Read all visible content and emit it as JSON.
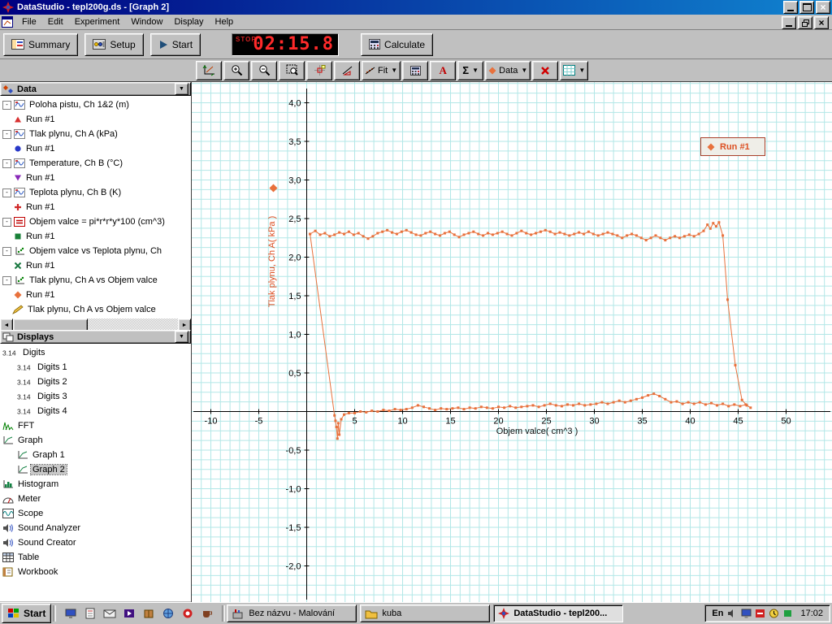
{
  "titlebar": {
    "title": "DataStudio - tepl200g.ds - [Graph 2]"
  },
  "menu": {
    "items": [
      "File",
      "Edit",
      "Experiment",
      "Window",
      "Display",
      "Help"
    ]
  },
  "toolbar": {
    "summary_label": "Summary",
    "setup_label": "Setup",
    "start_label": "Start",
    "calculate_label": "Calculate",
    "timer_stop": "STOP",
    "timer_value": "02:15.8"
  },
  "graph_toolbar": {
    "fit_label": "Fit",
    "sigma_label": "Σ",
    "text_label": "A",
    "data_label": "Data"
  },
  "data_panel": {
    "title": "Data",
    "items": [
      {
        "type": "source",
        "label": "Poloha pistu, Ch 1&2 (m)",
        "icon": "measurement-icon"
      },
      {
        "type": "run",
        "label": "Run #1",
        "marker": "triangle-up",
        "color": "#d83030"
      },
      {
        "type": "source",
        "label": "Tlak plynu, Ch A (kPa)",
        "icon": "measurement-icon"
      },
      {
        "type": "run",
        "label": "Run #1",
        "marker": "circle",
        "color": "#2838c8"
      },
      {
        "type": "source",
        "label": "Temperature, Ch B (°C)",
        "icon": "measurement-icon"
      },
      {
        "type": "run",
        "label": "Run #1",
        "marker": "triangle-down",
        "color": "#8828b8"
      },
      {
        "type": "source",
        "label": "Teplota plynu, Ch B (K)",
        "icon": "measurement-icon"
      },
      {
        "type": "run",
        "label": "Run #1",
        "marker": "plus",
        "color": "#d02828"
      },
      {
        "type": "source",
        "label": "Objem valce = pi*r*r*y*100 (cm^3)",
        "icon": "calculator-tree-icon"
      },
      {
        "type": "run",
        "label": "Run #1",
        "marker": "square",
        "color": "#188038"
      },
      {
        "type": "source",
        "label": "Objem valce vs Teplota plynu, Ch",
        "icon": "xy-icon"
      },
      {
        "type": "run",
        "label": "Run #1",
        "marker": "x",
        "color": "#187840"
      },
      {
        "type": "source",
        "label": "Tlak plynu, Ch A vs Objem valce",
        "icon": "xy-icon"
      },
      {
        "type": "run",
        "label": "Run #1",
        "marker": "diamond",
        "color": "#e8713c"
      },
      {
        "type": "source",
        "label": "Tlak plynu, Ch A vs Objem valce",
        "icon": "pen-icon",
        "expand": false
      }
    ]
  },
  "displays_panel": {
    "title": "Displays",
    "items": [
      {
        "label": "Digits",
        "icon": "digits-icon",
        "indent": 0
      },
      {
        "label": "Digits 1",
        "icon": "digits-icon",
        "indent": 1
      },
      {
        "label": "Digits 2",
        "icon": "digits-icon",
        "indent": 1
      },
      {
        "label": "Digits 3",
        "icon": "digits-icon",
        "indent": 1
      },
      {
        "label": "Digits 4",
        "icon": "digits-icon",
        "indent": 1
      },
      {
        "label": "FFT",
        "icon": "fft-icon",
        "indent": 0
      },
      {
        "label": "Graph",
        "icon": "graph-icon",
        "indent": 0
      },
      {
        "label": "Graph 1",
        "icon": "graph-icon",
        "indent": 1
      },
      {
        "label": "Graph 2",
        "icon": "graph-icon",
        "indent": 1,
        "selected": true
      },
      {
        "label": "Histogram",
        "icon": "histogram-icon",
        "indent": 0
      },
      {
        "label": "Meter",
        "icon": "meter-icon",
        "indent": 0
      },
      {
        "label": "Scope",
        "icon": "scope-icon",
        "indent": 0
      },
      {
        "label": "Sound Analyzer",
        "icon": "sound-icon",
        "indent": 0
      },
      {
        "label": "Sound Creator",
        "icon": "sound-icon",
        "indent": 0
      },
      {
        "label": "Table",
        "icon": "table-icon",
        "indent": 0
      },
      {
        "label": "Workbook",
        "icon": "workbook-icon",
        "indent": 0
      }
    ]
  },
  "chart_data": {
    "type": "line",
    "title": "Graph 2",
    "xlabel": "Objem valce( cm^3 )",
    "ylabel": "Tlak plynu, Ch A( kPa )",
    "xlim": [
      -12,
      55
    ],
    "ylim": [
      -2.5,
      4.3
    ],
    "grid": true,
    "grid_color": "#b2e7e7",
    "legend": {
      "label": "Run #1",
      "marker": "diamond",
      "position": "top-right"
    },
    "x_ticks": [
      [
        -10,
        "-10"
      ],
      [
        -5,
        "-5"
      ],
      [
        5,
        "5"
      ],
      [
        10,
        "10"
      ],
      [
        15,
        "15"
      ],
      [
        20,
        "20"
      ],
      [
        25,
        "25"
      ],
      [
        30,
        "30"
      ],
      [
        35,
        "35"
      ],
      [
        40,
        "40"
      ],
      [
        45,
        "45"
      ],
      [
        50,
        "50"
      ]
    ],
    "y_ticks": [
      [
        4,
        "4,0"
      ],
      [
        3.5,
        "3,5"
      ],
      [
        3,
        "3,0"
      ],
      [
        2.5,
        "2,5"
      ],
      [
        2,
        "2,0"
      ],
      [
        1.5,
        "1,5"
      ],
      [
        1,
        "1,0"
      ],
      [
        0.5,
        "0,5"
      ],
      [
        -0.5,
        "-0,5"
      ],
      [
        -1,
        "-1,0"
      ],
      [
        -1.5,
        "-1,5"
      ],
      [
        -2,
        "-2,0"
      ]
    ],
    "series": [
      {
        "name": "Run #1",
        "color": "#e8713c",
        "points": [
          [
            0.35,
            2.3
          ],
          [
            0.9,
            2.34
          ],
          [
            1.4,
            2.29
          ],
          [
            1.9,
            2.31
          ],
          [
            2.4,
            2.27
          ],
          [
            2.9,
            2.29
          ],
          [
            3.4,
            2.32
          ],
          [
            3.9,
            2.3
          ],
          [
            4.4,
            2.33
          ],
          [
            4.9,
            2.29
          ],
          [
            5.4,
            2.31
          ],
          [
            5.9,
            2.27
          ],
          [
            6.4,
            2.24
          ],
          [
            6.9,
            2.27
          ],
          [
            7.4,
            2.31
          ],
          [
            7.9,
            2.33
          ],
          [
            8.4,
            2.35
          ],
          [
            8.9,
            2.32
          ],
          [
            9.4,
            2.3
          ],
          [
            9.9,
            2.33
          ],
          [
            10.4,
            2.35
          ],
          [
            10.9,
            2.32
          ],
          [
            11.4,
            2.29
          ],
          [
            11.9,
            2.28
          ],
          [
            12.4,
            2.31
          ],
          [
            12.9,
            2.33
          ],
          [
            13.4,
            2.3
          ],
          [
            13.9,
            2.28
          ],
          [
            14.4,
            2.31
          ],
          [
            14.9,
            2.33
          ],
          [
            15.4,
            2.29
          ],
          [
            15.9,
            2.26
          ],
          [
            16.4,
            2.29
          ],
          [
            16.9,
            2.31
          ],
          [
            17.4,
            2.33
          ],
          [
            17.9,
            2.3
          ],
          [
            18.4,
            2.28
          ],
          [
            18.9,
            2.31
          ],
          [
            19.4,
            2.29
          ],
          [
            19.9,
            2.31
          ],
          [
            20.4,
            2.33
          ],
          [
            20.9,
            2.3
          ],
          [
            21.4,
            2.28
          ],
          [
            21.9,
            2.31
          ],
          [
            22.4,
            2.34
          ],
          [
            22.9,
            2.31
          ],
          [
            23.4,
            2.29
          ],
          [
            23.9,
            2.31
          ],
          [
            24.4,
            2.33
          ],
          [
            24.9,
            2.35
          ],
          [
            25.4,
            2.33
          ],
          [
            25.9,
            2.3
          ],
          [
            26.4,
            2.32
          ],
          [
            26.9,
            2.3
          ],
          [
            27.4,
            2.28
          ],
          [
            27.9,
            2.3
          ],
          [
            28.4,
            2.32
          ],
          [
            28.9,
            2.3
          ],
          [
            29.4,
            2.33
          ],
          [
            29.9,
            2.3
          ],
          [
            30.4,
            2.28
          ],
          [
            30.9,
            2.3
          ],
          [
            31.4,
            2.32
          ],
          [
            31.9,
            2.3
          ],
          [
            32.4,
            2.28
          ],
          [
            32.9,
            2.25
          ],
          [
            33.4,
            2.28
          ],
          [
            33.9,
            2.3
          ],
          [
            34.4,
            2.28
          ],
          [
            34.9,
            2.25
          ],
          [
            35.4,
            2.22
          ],
          [
            35.9,
            2.25
          ],
          [
            36.4,
            2.28
          ],
          [
            36.9,
            2.25
          ],
          [
            37.4,
            2.22
          ],
          [
            37.9,
            2.25
          ],
          [
            38.4,
            2.27
          ],
          [
            38.9,
            2.25
          ],
          [
            39.4,
            2.27
          ],
          [
            39.9,
            2.29
          ],
          [
            40.4,
            2.27
          ],
          [
            40.9,
            2.3
          ],
          [
            41.4,
            2.34
          ],
          [
            41.8,
            2.42
          ],
          [
            42.1,
            2.37
          ],
          [
            42.4,
            2.44
          ],
          [
            42.7,
            2.4
          ],
          [
            43.0,
            2.45
          ],
          [
            43.4,
            2.28
          ],
          [
            43.9,
            1.45
          ],
          [
            44.7,
            0.6
          ],
          [
            45.4,
            0.15
          ],
          [
            45.9,
            0.08
          ],
          [
            46.3,
            0.05
          ],
          [
            45.8,
            0.09
          ],
          [
            45.2,
            0.07
          ],
          [
            44.6,
            0.09
          ],
          [
            44.0,
            0.07
          ],
          [
            43.4,
            0.1
          ],
          [
            42.8,
            0.08
          ],
          [
            42.2,
            0.11
          ],
          [
            41.6,
            0.09
          ],
          [
            41.0,
            0.12
          ],
          [
            40.4,
            0.1
          ],
          [
            39.8,
            0.12
          ],
          [
            39.2,
            0.1
          ],
          [
            38.6,
            0.13
          ],
          [
            38.0,
            0.12
          ],
          [
            37.4,
            0.16
          ],
          [
            36.8,
            0.2
          ],
          [
            36.2,
            0.23
          ],
          [
            35.6,
            0.21
          ],
          [
            35.0,
            0.18
          ],
          [
            34.4,
            0.16
          ],
          [
            33.8,
            0.14
          ],
          [
            33.2,
            0.12
          ],
          [
            32.6,
            0.14
          ],
          [
            32.0,
            0.12
          ],
          [
            31.4,
            0.1
          ],
          [
            30.8,
            0.12
          ],
          [
            30.2,
            0.1
          ],
          [
            29.6,
            0.09
          ],
          [
            29.0,
            0.08
          ],
          [
            28.4,
            0.1
          ],
          [
            27.8,
            0.08
          ],
          [
            27.2,
            0.09
          ],
          [
            26.6,
            0.07
          ],
          [
            26.0,
            0.08
          ],
          [
            25.4,
            0.1
          ],
          [
            24.8,
            0.08
          ],
          [
            24.2,
            0.06
          ],
          [
            23.6,
            0.08
          ],
          [
            23.0,
            0.07
          ],
          [
            22.4,
            0.06
          ],
          [
            21.8,
            0.05
          ],
          [
            21.2,
            0.07
          ],
          [
            20.6,
            0.05
          ],
          [
            20.0,
            0.06
          ],
          [
            19.4,
            0.04
          ],
          [
            18.8,
            0.05
          ],
          [
            18.2,
            0.06
          ],
          [
            17.6,
            0.04
          ],
          [
            17.0,
            0.05
          ],
          [
            16.4,
            0.03
          ],
          [
            15.8,
            0.05
          ],
          [
            15.2,
            0.04
          ],
          [
            14.6,
            0.03
          ],
          [
            14.0,
            0.04
          ],
          [
            13.4,
            0.02
          ],
          [
            12.8,
            0.04
          ],
          [
            12.2,
            0.06
          ],
          [
            11.6,
            0.08
          ],
          [
            11.0,
            0.05
          ],
          [
            10.4,
            0.03
          ],
          [
            9.8,
            0.02
          ],
          [
            9.2,
            0.03
          ],
          [
            8.6,
            0.01
          ],
          [
            8.0,
            0.02
          ],
          [
            7.4,
            0.0
          ],
          [
            6.8,
            0.01
          ],
          [
            6.2,
            -0.01
          ],
          [
            5.6,
            0.0
          ],
          [
            5.0,
            -0.02
          ],
          [
            4.4,
            -0.02
          ],
          [
            3.9,
            -0.04
          ],
          [
            3.6,
            -0.1
          ],
          [
            3.4,
            -0.3
          ],
          [
            3.3,
            -0.15
          ],
          [
            3.2,
            -0.35
          ],
          [
            3.1,
            -0.2
          ],
          [
            3.0,
            -0.12
          ],
          [
            2.9,
            -0.05
          ],
          [
            0.35,
            2.3
          ]
        ]
      }
    ]
  },
  "taskbar": {
    "start_label": "Start",
    "quick_launch": [
      {
        "name": "quicklaunch-desktop-icon"
      },
      {
        "name": "quicklaunch-document-icon"
      },
      {
        "name": "quicklaunch-mail-icon"
      },
      {
        "name": "quicklaunch-media-icon"
      },
      {
        "name": "quicklaunch-package-icon"
      },
      {
        "name": "quicklaunch-globe-icon"
      },
      {
        "name": "quicklaunch-red-app-icon"
      },
      {
        "name": "quicklaunch-coffee-icon"
      }
    ],
    "tasks": [
      {
        "label": "Bez názvu - Malování",
        "icon": "paint-icon",
        "active": false
      },
      {
        "label": "kuba",
        "icon": "folder-icon",
        "active": false
      },
      {
        "label": "DataStudio - tepl200...",
        "icon": "datastudio-icon",
        "active": true
      }
    ],
    "tray": {
      "lang": "En",
      "icons": [
        {
          "name": "tray-volume-icon"
        },
        {
          "name": "tray-display-icon"
        },
        {
          "name": "tray-antivirus-icon"
        },
        {
          "name": "tray-schedule-icon"
        },
        {
          "name": "tray-green-icon"
        }
      ],
      "clock": "17:02"
    }
  }
}
